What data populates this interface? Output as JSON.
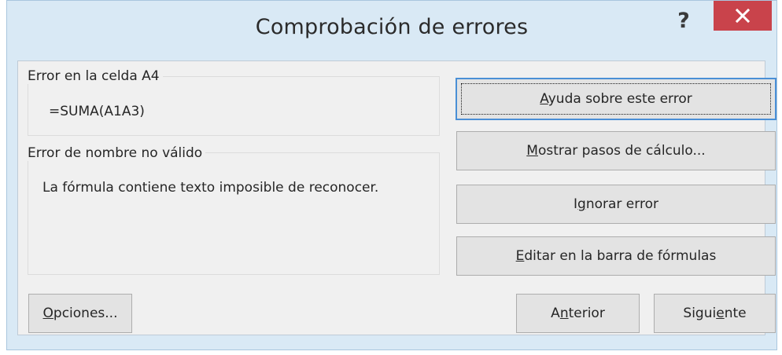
{
  "dialog": {
    "title": "Comprobación de errores",
    "help_icon": "question-mark-icon",
    "help_glyph": "?",
    "close_icon": "close-icon"
  },
  "error_location": {
    "legend": "Error en la celda A4",
    "formula": "=SUMA(A1A3)"
  },
  "error_info": {
    "legend": "Error de nombre no válido",
    "description": "La fórmula contiene texto imposible de reconocer."
  },
  "buttons": {
    "help": {
      "pre": "",
      "key": "A",
      "post": "yuda sobre este error"
    },
    "show_steps": {
      "pre": "",
      "key": "M",
      "post": "ostrar pasos de cálculo..."
    },
    "ignore": {
      "pre": "I",
      "key": "g",
      "post": "norar error"
    },
    "edit": {
      "pre": "",
      "key": "E",
      "post": "ditar en la barra de fórmulas"
    },
    "options": {
      "pre": "",
      "key": "O",
      "post": "pciones..."
    },
    "previous": {
      "pre": "A",
      "key": "n",
      "post": "terior"
    },
    "next": {
      "pre": "Sigui",
      "key": "e",
      "post": "nte"
    }
  },
  "colors": {
    "close_button": "#c9434b",
    "frame": "#d9e9f5",
    "default_button_border": "#4a8fd6"
  }
}
